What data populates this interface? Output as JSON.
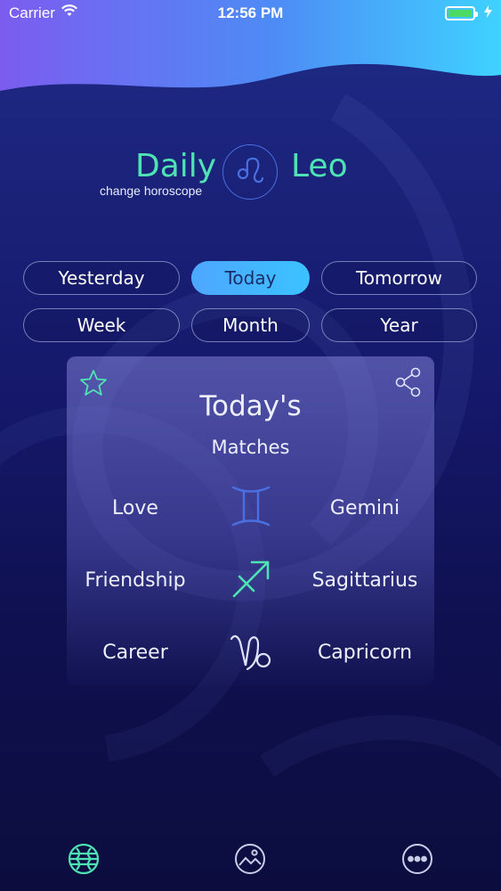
{
  "status_bar": {
    "carrier": "Carrier",
    "time": "12:56 PM"
  },
  "header": {
    "daily_label": "Daily",
    "change_label": "change horoscope",
    "sign_label": "Leo",
    "sign_icon": "leo-icon"
  },
  "periods": [
    {
      "label": "Yesterday",
      "active": false
    },
    {
      "label": "Today",
      "active": true
    },
    {
      "label": "Tomorrow",
      "active": false
    },
    {
      "label": "Week",
      "active": false
    },
    {
      "label": "Month",
      "active": false
    },
    {
      "label": "Year",
      "active": false
    }
  ],
  "card": {
    "title": "Today's",
    "subtitle": "Matches",
    "favorite_icon": "star-icon",
    "share_icon": "share-icon",
    "matches": [
      {
        "category": "Love",
        "sign": "Gemini",
        "icon": "gemini-icon"
      },
      {
        "category": "Friendship",
        "sign": "Sagittarius",
        "icon": "sagittarius-icon"
      },
      {
        "category": "Career",
        "sign": "Capricorn",
        "icon": "capricorn-icon"
      }
    ]
  },
  "tab_bar": {
    "items": [
      {
        "icon": "horoscope-globe-icon",
        "active": true
      },
      {
        "icon": "picture-icon",
        "active": false
      },
      {
        "icon": "more-icon",
        "active": false
      }
    ]
  },
  "colors": {
    "accent_green": "#4fe3b4",
    "active_pill": "#3ac2ff",
    "background": "#13134a"
  }
}
